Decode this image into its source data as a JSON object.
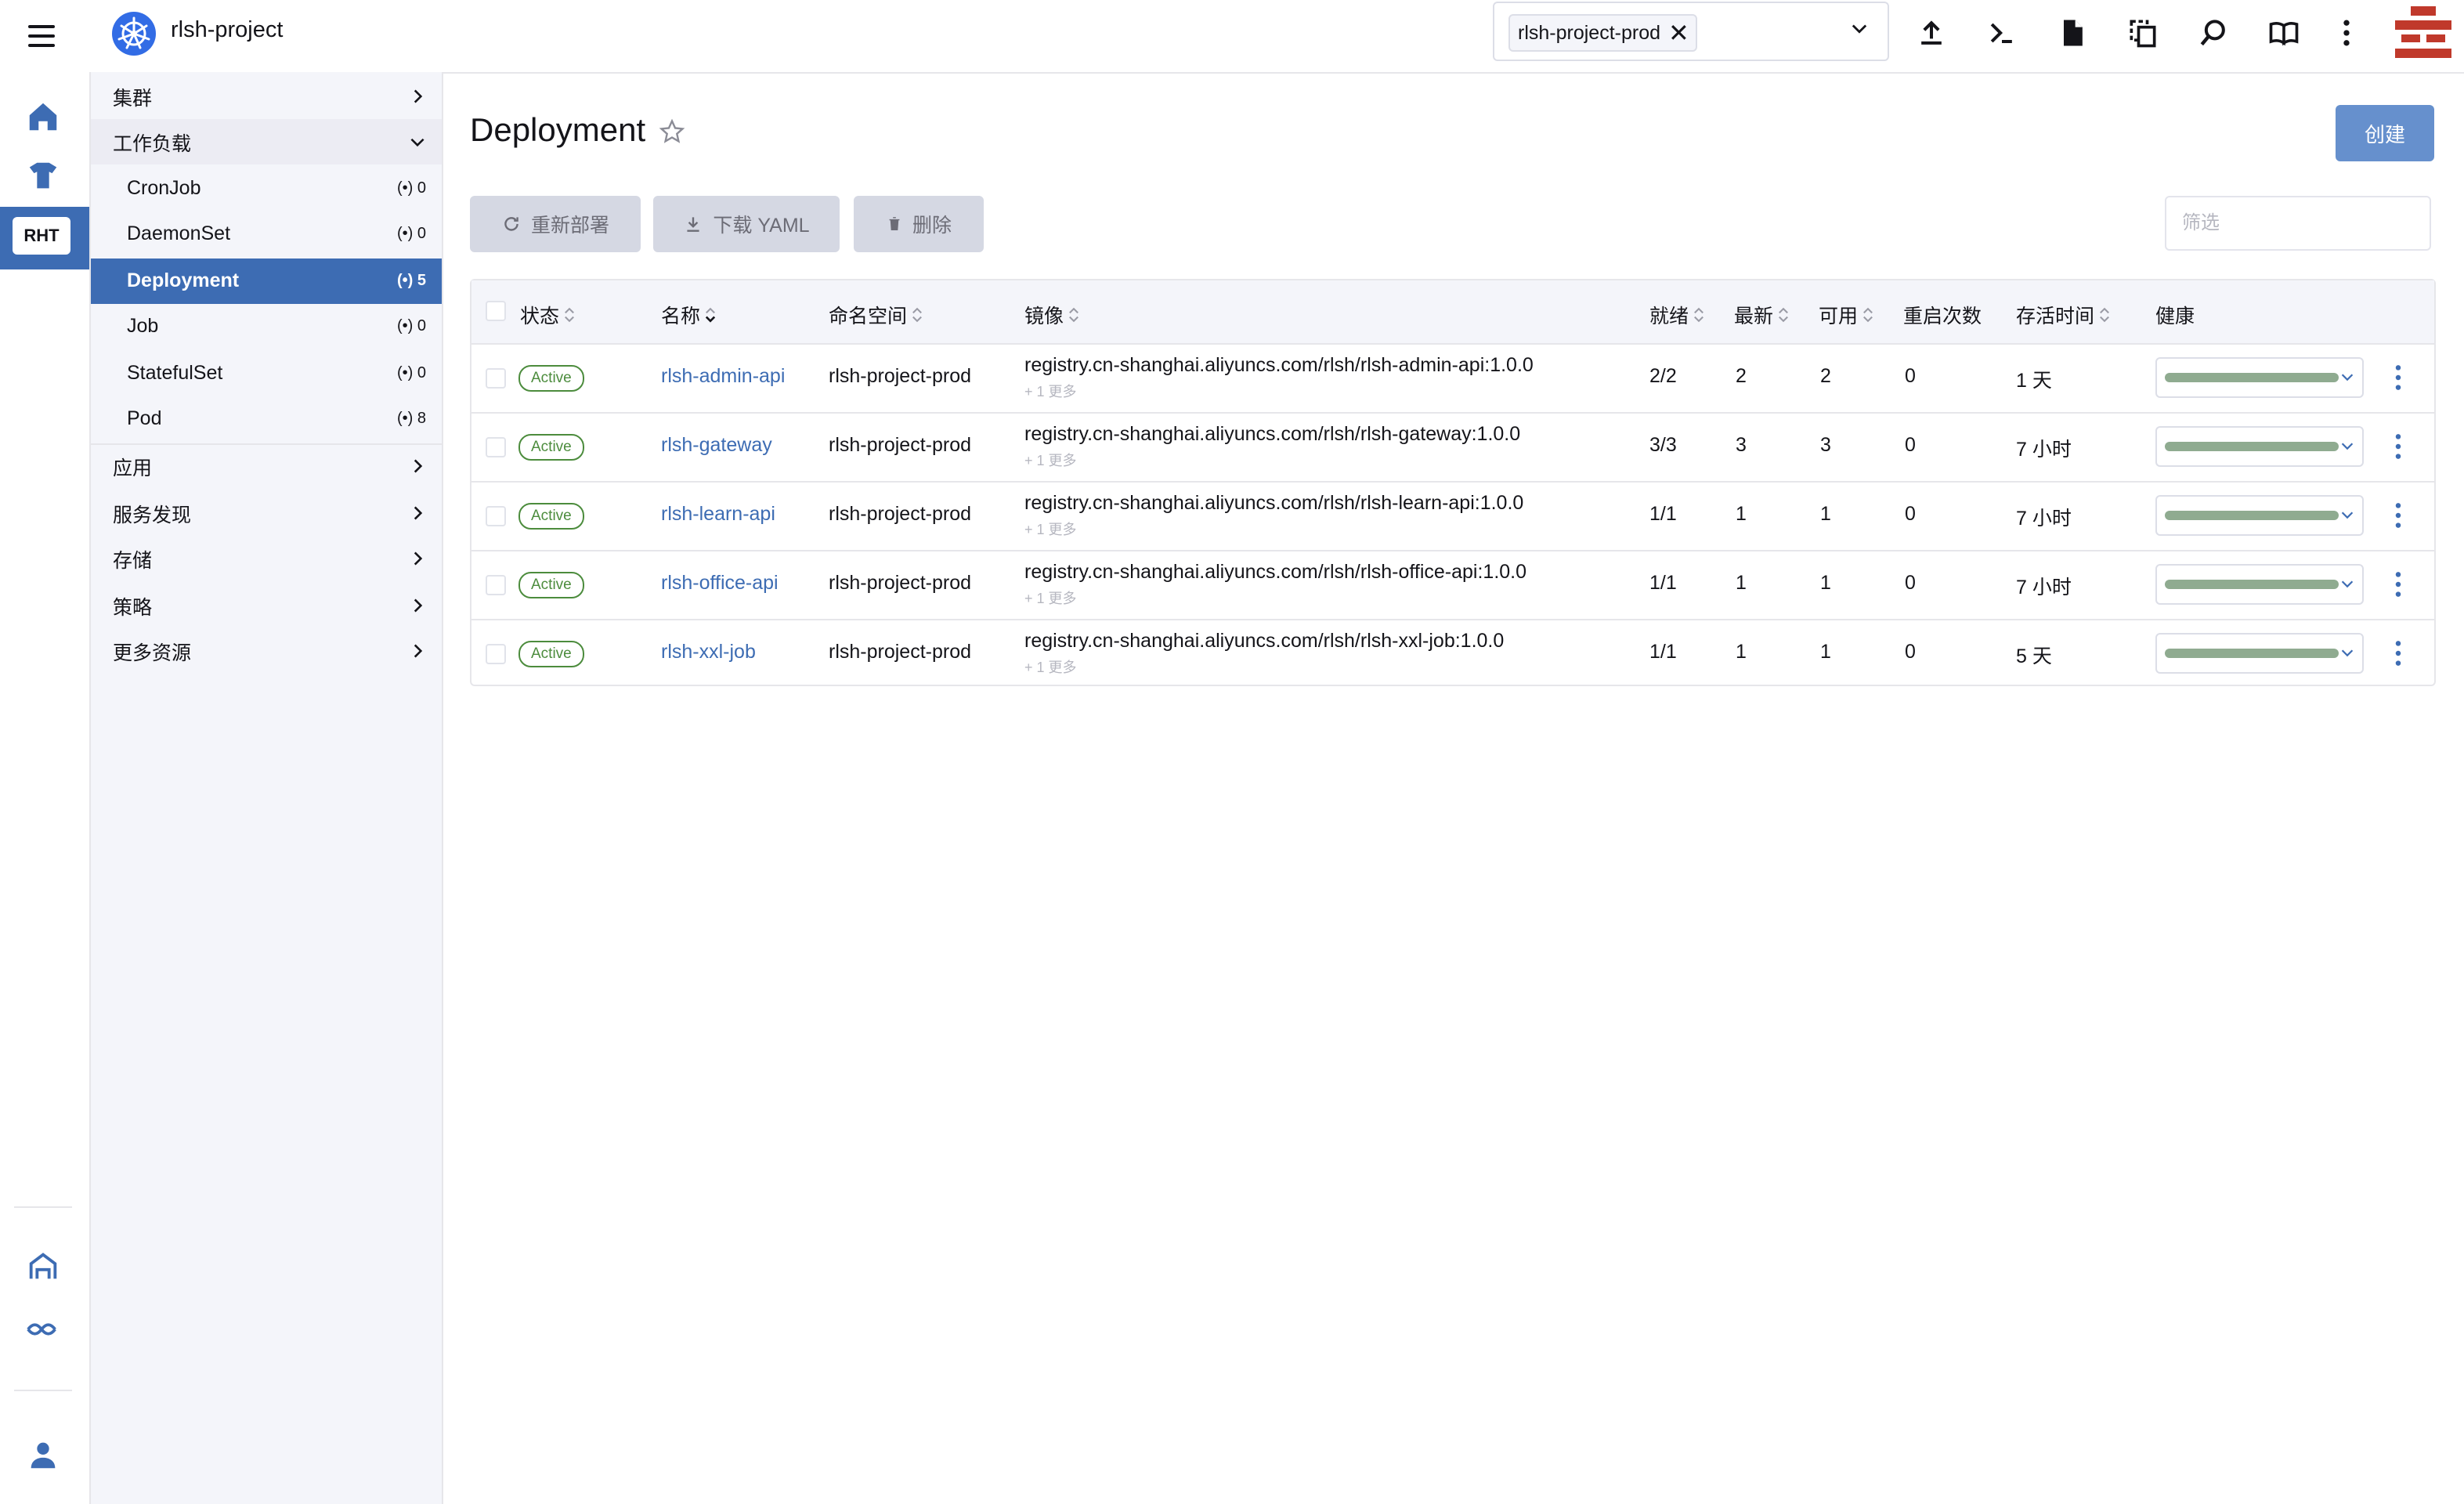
{
  "header": {
    "cluster_name": "rlsh-project",
    "namespace_chip": "rlsh-project-prod"
  },
  "rail": {
    "active_label": "RHT"
  },
  "nav": {
    "cluster": "集群",
    "workloads": "工作负载",
    "items": [
      {
        "label": "CronJob",
        "count": "0"
      },
      {
        "label": "DaemonSet",
        "count": "0"
      },
      {
        "label": "Deployment",
        "count": "5"
      },
      {
        "label": "Job",
        "count": "0"
      },
      {
        "label": "StatefulSet",
        "count": "0"
      },
      {
        "label": "Pod",
        "count": "8"
      }
    ],
    "groups": [
      "应用",
      "服务发现",
      "存储",
      "策略",
      "更多资源"
    ],
    "count_icon": "(•)"
  },
  "page": {
    "title": "Deployment",
    "create": "创建",
    "redeploy": "重新部署",
    "download": "下载 YAML",
    "delete": "删除",
    "filter_placeholder": "筛选"
  },
  "table": {
    "headers": {
      "state": "状态",
      "name": "名称",
      "namespace": "命名空间",
      "image": "镜像",
      "ready": "就绪",
      "uptodate": "最新",
      "available": "可用",
      "restarts": "重启次数",
      "age": "存活时间",
      "health": "健康"
    },
    "rows": [
      {
        "state": "Active",
        "name": "rlsh-admin-api",
        "namespace": "rlsh-project-prod",
        "image": "registry.cn-shanghai.aliyuncs.com/rlsh/rlsh-admin-api:1.0.0",
        "more": "+ 1 更多",
        "ready": "2/2",
        "uptodate": "2",
        "available": "2",
        "restarts": "0",
        "age": "1 天"
      },
      {
        "state": "Active",
        "name": "rlsh-gateway",
        "namespace": "rlsh-project-prod",
        "image": "registry.cn-shanghai.aliyuncs.com/rlsh/rlsh-gateway:1.0.0",
        "more": "+ 1 更多",
        "ready": "3/3",
        "uptodate": "3",
        "available": "3",
        "restarts": "0",
        "age": "7 小时"
      },
      {
        "state": "Active",
        "name": "rlsh-learn-api",
        "namespace": "rlsh-project-prod",
        "image": "registry.cn-shanghai.aliyuncs.com/rlsh/rlsh-learn-api:1.0.0",
        "more": "+ 1 更多",
        "ready": "1/1",
        "uptodate": "1",
        "available": "1",
        "restarts": "0",
        "age": "7 小时"
      },
      {
        "state": "Active",
        "name": "rlsh-office-api",
        "namespace": "rlsh-project-prod",
        "image": "registry.cn-shanghai.aliyuncs.com/rlsh/rlsh-office-api:1.0.0",
        "more": "+ 1 更多",
        "ready": "1/1",
        "uptodate": "1",
        "available": "1",
        "restarts": "0",
        "age": "7 小时"
      },
      {
        "state": "Active",
        "name": "rlsh-xxl-job",
        "namespace": "rlsh-project-prod",
        "image": "registry.cn-shanghai.aliyuncs.com/rlsh/rlsh-xxl-job:1.0.0",
        "more": "+ 1 更多",
        "ready": "1/1",
        "uptodate": "1",
        "available": "1",
        "restarts": "0",
        "age": "5 天"
      }
    ]
  },
  "colors": {
    "accent": "#3d6cb3",
    "active_badge": "#4c8c3d",
    "health_bar": "#8fab90",
    "sidebar_bg": "#f4f5fa"
  },
  "icons": [
    "menu-icon",
    "kubernetes-logo-icon",
    "upload-icon",
    "terminal-icon",
    "file-icon",
    "copy-icon",
    "search-icon",
    "book-icon",
    "more-vertical-icon",
    "home-icon",
    "shirt-icon",
    "rancher-icon",
    "fleet-icon",
    "user-icon",
    "star-icon",
    "refresh-icon",
    "download-icon",
    "trash-icon",
    "chevron-right-icon",
    "chevron-down-icon",
    "sort-icon",
    "kebab-icon"
  ]
}
